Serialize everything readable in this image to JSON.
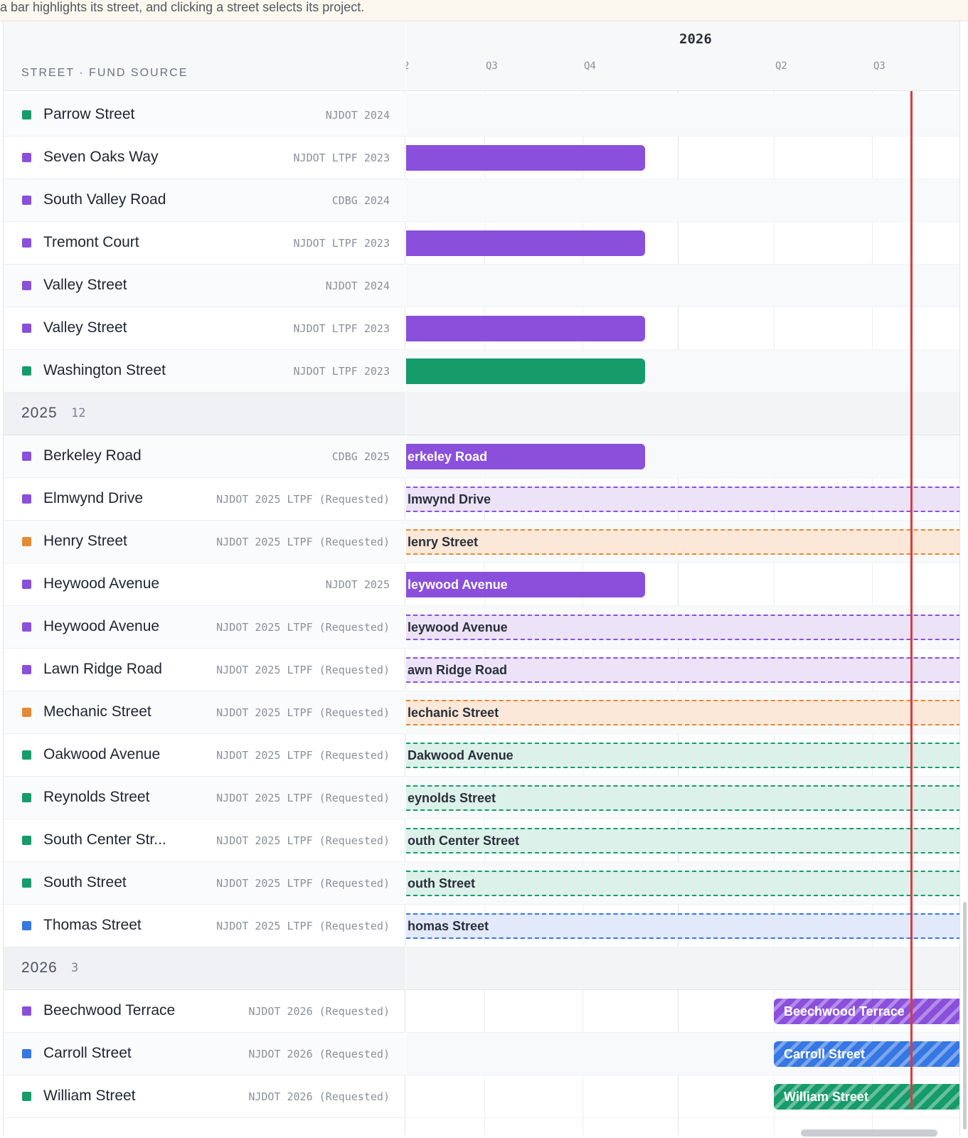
{
  "hint": "a bar highlights its street, and clicking a street selects its project.",
  "header": {
    "column_label": "STREET · FUND SOURCE",
    "year_label": "2026",
    "quarters": [
      "Q3",
      "Q4",
      "Q2",
      "Q3"
    ]
  },
  "colors": {
    "purple": "#8a4fdb",
    "green": "#169b6b",
    "orange": "#e58a32",
    "blue": "#3577e3",
    "today": "#dc3b3b"
  },
  "rows": [
    {
      "type": "project",
      "street": "Parrow Street",
      "fund": "NJDOT 2024",
      "color": "green"
    },
    {
      "type": "project",
      "street": "Seven Oaks Way",
      "fund": "NJDOT LTPF 2023",
      "color": "purple"
    },
    {
      "type": "project",
      "street": "South Valley Road",
      "fund": "CDBG 2024",
      "color": "purple"
    },
    {
      "type": "project",
      "street": "Tremont Court",
      "fund": "NJDOT LTPF 2023",
      "color": "purple"
    },
    {
      "type": "project",
      "street": "Valley Street",
      "fund": "NJDOT 2024",
      "color": "purple"
    },
    {
      "type": "project",
      "street": "Valley Street",
      "fund": "NJDOT LTPF 2023",
      "color": "purple"
    },
    {
      "type": "project",
      "street": "Washington Street",
      "fund": "NJDOT LTPF 2023",
      "color": "green"
    },
    {
      "type": "group",
      "year": "2025",
      "count": "12"
    },
    {
      "type": "project",
      "street": "Berkeley Road",
      "fund": "CDBG 2025",
      "color": "purple"
    },
    {
      "type": "project",
      "street": "Elmwynd Drive",
      "fund": "NJDOT 2025 LTPF (Requested)",
      "color": "purple"
    },
    {
      "type": "project",
      "street": "Henry Street",
      "fund": "NJDOT 2025 LTPF (Requested)",
      "color": "orange"
    },
    {
      "type": "project",
      "street": "Heywood Avenue",
      "fund": "NJDOT 2025",
      "color": "purple"
    },
    {
      "type": "project",
      "street": "Heywood Avenue",
      "fund": "NJDOT 2025 LTPF (Requested)",
      "color": "purple"
    },
    {
      "type": "project",
      "street": "Lawn Ridge Road",
      "fund": "NJDOT 2025 LTPF (Requested)",
      "color": "purple"
    },
    {
      "type": "project",
      "street": "Mechanic Street",
      "fund": "NJDOT 2025 LTPF (Requested)",
      "color": "orange"
    },
    {
      "type": "project",
      "street": "Oakwood Avenue",
      "fund": "NJDOT 2025 LTPF (Requested)",
      "color": "green"
    },
    {
      "type": "project",
      "street": "Reynolds Street",
      "fund": "NJDOT 2025 LTPF (Requested)",
      "color": "green"
    },
    {
      "type": "project",
      "street": "South Center Str...",
      "fund": "NJDOT 2025 LTPF (Requested)",
      "color": "green"
    },
    {
      "type": "project",
      "street": "South Street",
      "fund": "NJDOT 2025 LTPF (Requested)",
      "color": "green"
    },
    {
      "type": "project",
      "street": "Thomas Street",
      "fund": "NJDOT 2025 LTPF (Requested)",
      "color": "blue"
    },
    {
      "type": "group",
      "year": "2026",
      "count": "3"
    },
    {
      "type": "project",
      "street": "Beechwood Terrace",
      "fund": "NJDOT 2026 (Requested)",
      "color": "purple"
    },
    {
      "type": "project",
      "street": "Carroll Street",
      "fund": "NJDOT 2026 (Requested)",
      "color": "blue"
    },
    {
      "type": "project",
      "street": "William Street",
      "fund": "NJDOT 2026 (Requested)",
      "color": "green"
    }
  ],
  "bars": [
    {
      "row": 1,
      "label": "",
      "style": "solid",
      "color": "purple",
      "start": "before",
      "end": "Q4 2025"
    },
    {
      "row": 3,
      "label": "",
      "style": "solid",
      "color": "purple",
      "start": "before",
      "end": "Q4 2025"
    },
    {
      "row": 5,
      "label": "",
      "style": "solid",
      "color": "purple",
      "start": "before",
      "end": "Q4 2025"
    },
    {
      "row": 6,
      "label": "",
      "style": "solid",
      "color": "green",
      "start": "before",
      "end": "Q4 2025"
    },
    {
      "row": 8,
      "label": "erkeley Road",
      "style": "solid",
      "color": "purple",
      "start": "before",
      "end": "Q4 2025"
    },
    {
      "row": 9,
      "label": "lmwynd Drive",
      "style": "requested",
      "color": "purple",
      "start": "before",
      "end": "after"
    },
    {
      "row": 10,
      "label": "lenry Street",
      "style": "requested",
      "color": "orange",
      "start": "before",
      "end": "after"
    },
    {
      "row": 11,
      "label": "leywood Avenue",
      "style": "solid",
      "color": "purple",
      "start": "before",
      "end": "Q4 2025"
    },
    {
      "row": 12,
      "label": "leywood Avenue",
      "style": "requested",
      "color": "purple",
      "start": "before",
      "end": "after"
    },
    {
      "row": 13,
      "label": "awn Ridge Road",
      "style": "requested",
      "color": "purple",
      "start": "before",
      "end": "after"
    },
    {
      "row": 14,
      "label": "lechanic Street",
      "style": "requested",
      "color": "orange",
      "start": "before",
      "end": "after"
    },
    {
      "row": 15,
      "label": "Dakwood Avenue",
      "style": "requested",
      "color": "green",
      "start": "before",
      "end": "after"
    },
    {
      "row": 16,
      "label": "eynolds Street",
      "style": "requested",
      "color": "green",
      "start": "before",
      "end": "after"
    },
    {
      "row": 17,
      "label": "outh Center Street",
      "style": "requested",
      "color": "green",
      "start": "before",
      "end": "after"
    },
    {
      "row": 18,
      "label": "outh Street",
      "style": "requested",
      "color": "green",
      "start": "before",
      "end": "after"
    },
    {
      "row": 19,
      "label": "homas Street",
      "style": "requested",
      "color": "blue",
      "start": "before",
      "end": "after"
    },
    {
      "row": 21,
      "label": "Beechwood Terrace",
      "style": "hatched",
      "color": "purple",
      "start": "Q2 2026",
      "end": "after"
    },
    {
      "row": 22,
      "label": "Carroll Street",
      "style": "hatched",
      "color": "blue",
      "start": "Q2 2026",
      "end": "after"
    },
    {
      "row": 23,
      "label": "William Street",
      "style": "hatched",
      "color": "green",
      "start": "Q2 2026",
      "end": "after"
    }
  ]
}
